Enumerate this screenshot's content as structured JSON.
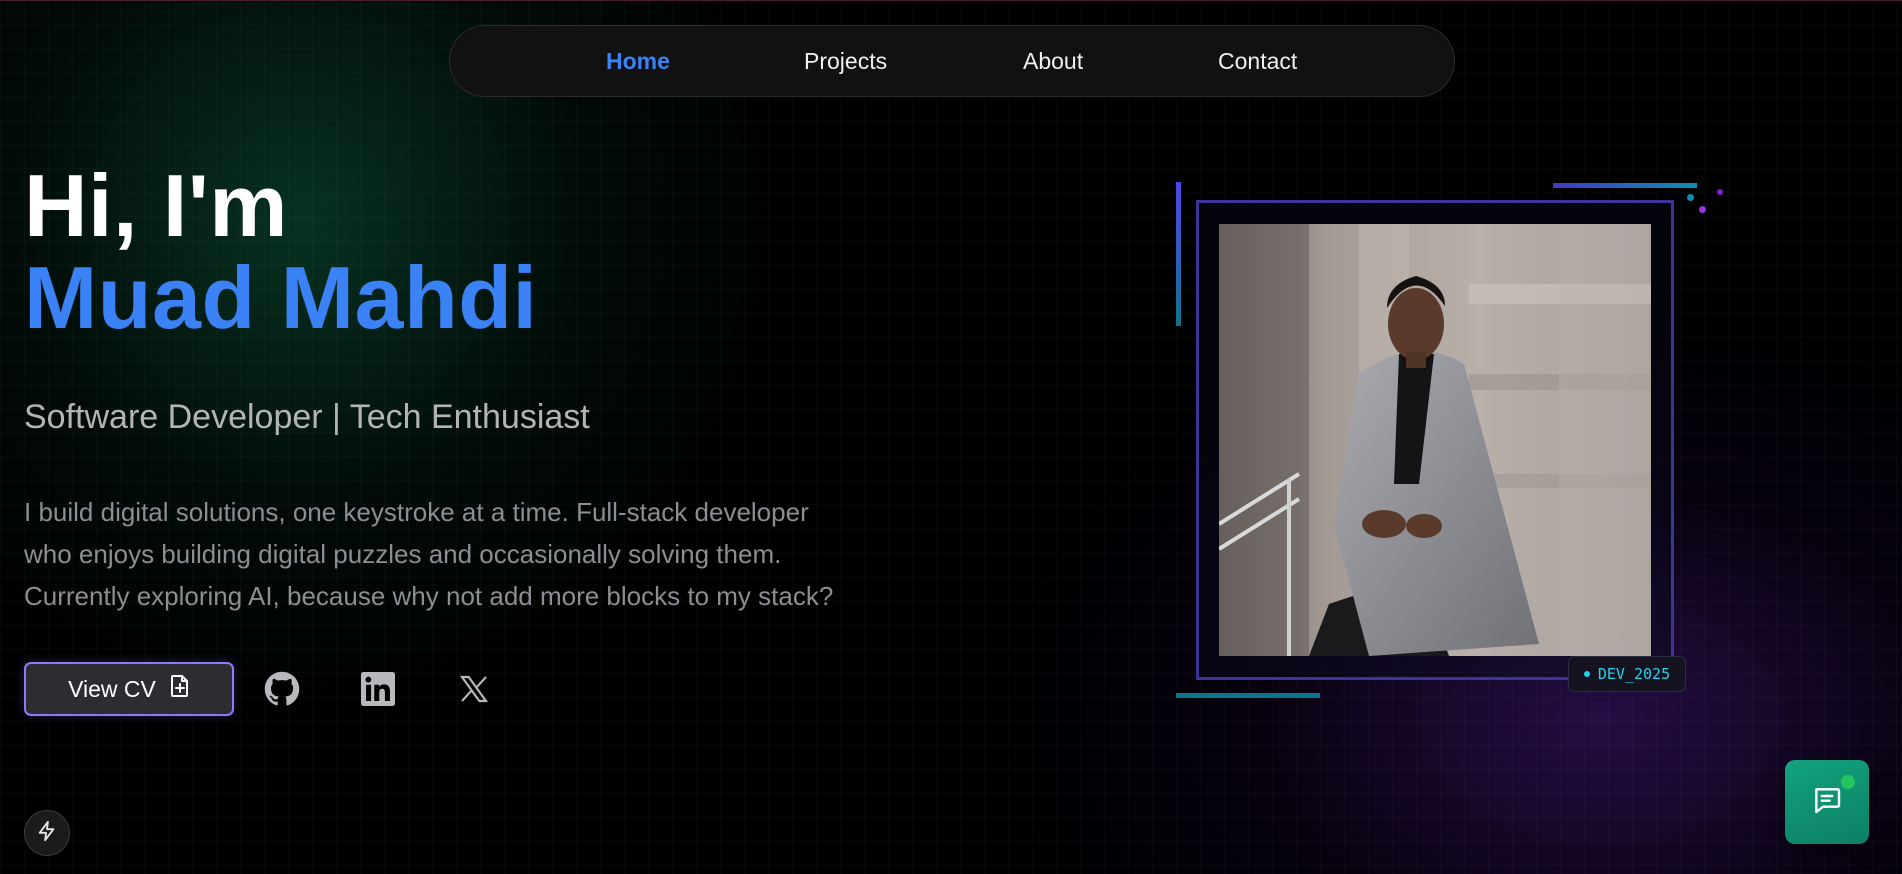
{
  "nav": {
    "items": [
      {
        "label": "Home",
        "active": true
      },
      {
        "label": "Projects",
        "active": false
      },
      {
        "label": "About",
        "active": false
      },
      {
        "label": "Contact",
        "active": false
      }
    ]
  },
  "hero": {
    "greeting": "Hi, I'm",
    "name": "Muad Mahdi",
    "role": "Software Developer | Tech Enthusiast",
    "bio_lines": [
      "I build digital solutions, one keystroke at a time. Full-stack developer",
      "who enjoys building digital puzzles and occasionally solving them.",
      "Currently exploring AI, because why not add more blocks to my stack?"
    ]
  },
  "actions": {
    "cv_label": "View CV",
    "cv_icon": "file-plus-icon",
    "socials": [
      "github-icon",
      "linkedin-icon",
      "x-icon"
    ]
  },
  "photo": {
    "badge": "DEV_2025"
  },
  "colors": {
    "accent": "#3b82f6",
    "frame": "#3c3597",
    "cyan": "#22d3ee",
    "chat": "#12a37d"
  },
  "icons": {
    "chat": "chat-icon",
    "bolt": "bolt-icon"
  }
}
